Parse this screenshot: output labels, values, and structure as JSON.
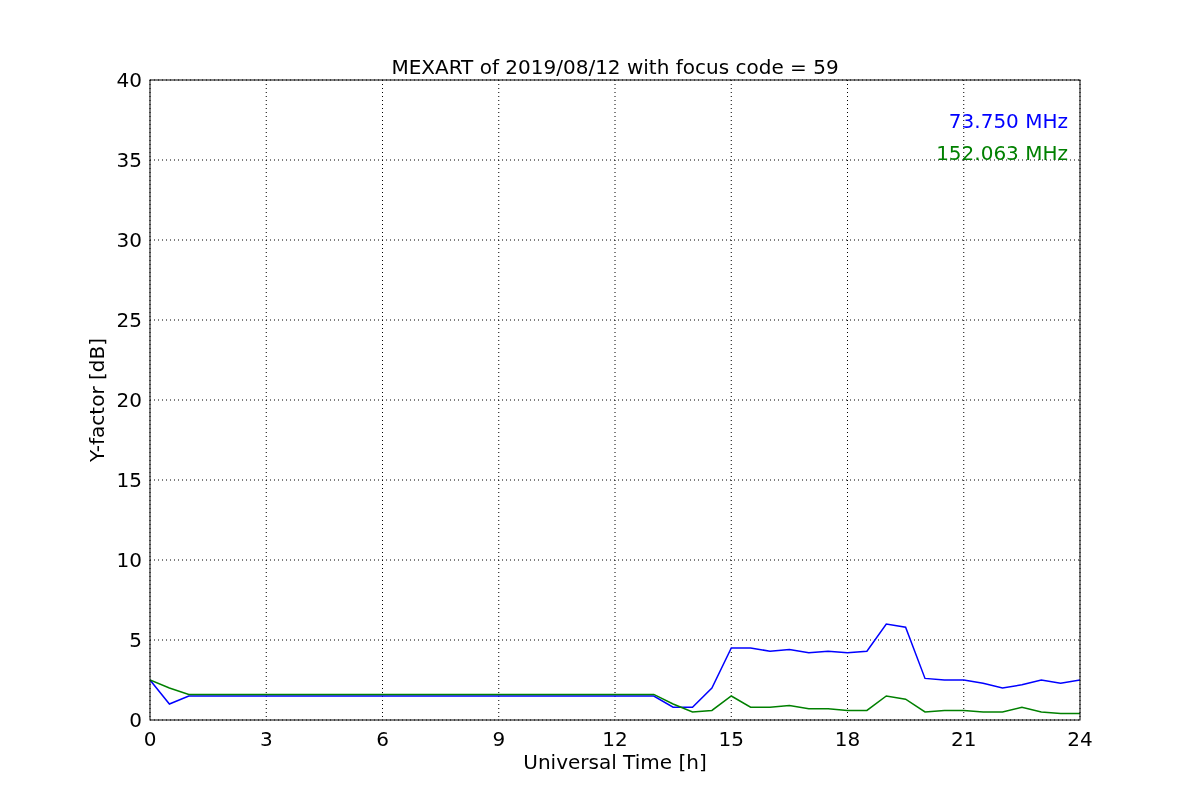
{
  "chart_data": {
    "type": "line",
    "title": "MEXART of 2019/08/12 with focus code = 59",
    "xlabel": "Universal Time [h]",
    "ylabel": "Y-factor [dB]",
    "x": [
      0,
      0.5,
      1,
      1.5,
      2,
      2.5,
      3,
      3.5,
      4,
      4.5,
      5,
      5.5,
      6,
      6.5,
      7,
      7.5,
      8,
      8.5,
      9,
      9.5,
      10,
      10.5,
      11,
      11.5,
      12,
      12.5,
      13,
      13.5,
      14,
      14.5,
      15,
      15.5,
      16,
      16.5,
      17,
      17.5,
      18,
      18.5,
      19,
      19.5,
      20,
      20.5,
      21,
      21.5,
      22,
      22.5,
      23,
      23.5,
      24
    ],
    "series": [
      {
        "name": "73.750 MHz",
        "color": "#0000ff",
        "values": [
          2.5,
          1,
          1.5,
          1.5,
          1.5,
          1.5,
          1.5,
          1.5,
          1.5,
          1.5,
          1.5,
          1.5,
          1.5,
          1.5,
          1.5,
          1.5,
          1.5,
          1.5,
          1.5,
          1.5,
          1.5,
          1.5,
          1.5,
          1.5,
          1.5,
          1.5,
          1.5,
          0.8,
          0.8,
          2,
          4.5,
          4.5,
          4.3,
          4.4,
          4.2,
          4.3,
          4.2,
          4.3,
          6,
          5.8,
          2.6,
          2.5,
          2.5,
          2.3,
          2,
          2.2,
          2.5,
          2.3,
          2.5
        ]
      },
      {
        "name": "152.063 MHz",
        "color": "#008000",
        "values": [
          2.5,
          2,
          1.6,
          1.6,
          1.6,
          1.6,
          1.6,
          1.6,
          1.6,
          1.6,
          1.6,
          1.6,
          1.6,
          1.6,
          1.6,
          1.6,
          1.6,
          1.6,
          1.6,
          1.6,
          1.6,
          1.6,
          1.6,
          1.6,
          1.6,
          1.6,
          1.6,
          1,
          0.5,
          0.6,
          1.5,
          0.8,
          0.8,
          0.9,
          0.7,
          0.7,
          0.6,
          0.6,
          1.5,
          1.3,
          0.5,
          0.6,
          0.6,
          0.5,
          0.5,
          0.8,
          0.5,
          0.4,
          0.4
        ]
      }
    ],
    "xlim": [
      0,
      24
    ],
    "ylim": [
      0,
      40
    ],
    "xticks": [
      0,
      3,
      6,
      9,
      12,
      15,
      18,
      21,
      24
    ],
    "yticks": [
      0,
      5,
      10,
      15,
      20,
      25,
      30,
      35,
      40
    ],
    "grid": true
  }
}
